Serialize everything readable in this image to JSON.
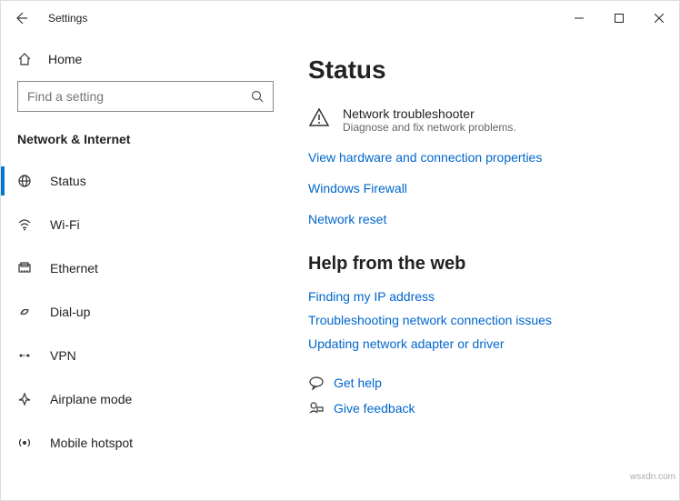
{
  "window": {
    "title": "Settings"
  },
  "sidebar": {
    "home_label": "Home",
    "search_placeholder": "Find a setting",
    "section_title": "Network & Internet",
    "items": [
      {
        "label": "Status"
      },
      {
        "label": "Wi-Fi"
      },
      {
        "label": "Ethernet"
      },
      {
        "label": "Dial-up"
      },
      {
        "label": "VPN"
      },
      {
        "label": "Airplane mode"
      },
      {
        "label": "Mobile hotspot"
      }
    ]
  },
  "main": {
    "page_title": "Status",
    "troubleshooter": {
      "title": "Network troubleshooter",
      "subtitle": "Diagnose and fix network problems."
    },
    "links": [
      "View hardware and connection properties",
      "Windows Firewall",
      "Network reset"
    ],
    "help_heading": "Help from the web",
    "help_links": [
      "Finding my IP address",
      "Troubleshooting network connection issues",
      "Updating network adapter or driver"
    ],
    "footer": {
      "get_help": "Get help",
      "give_feedback": "Give feedback"
    }
  },
  "watermark": "wsxdn.com"
}
